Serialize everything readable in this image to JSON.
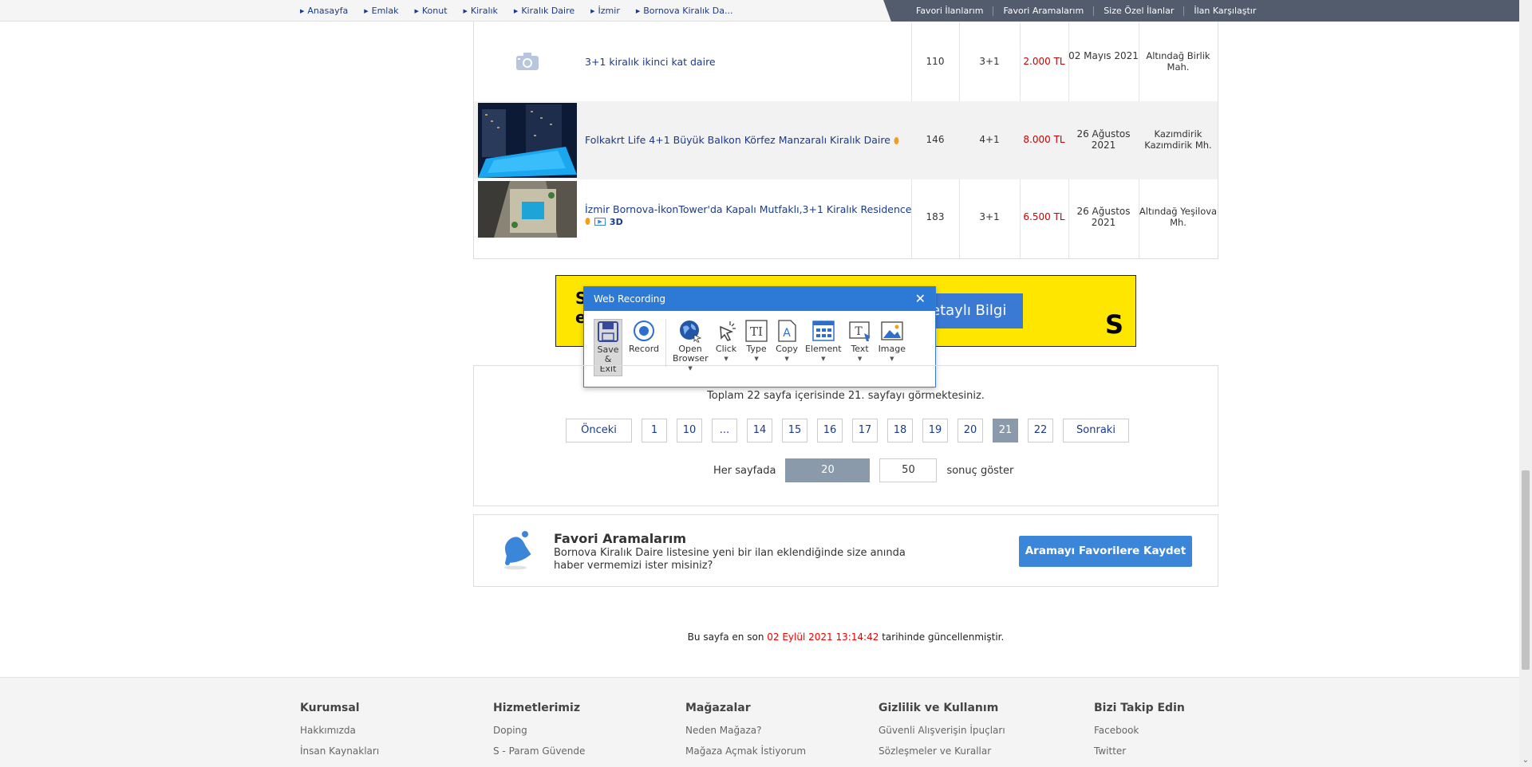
{
  "breadcrumb": [
    "Anasayfa",
    "Emlak",
    "Konut",
    "Kiralık",
    "Kiralık Daire",
    "İzmir",
    "Bornova Kiralık Da..."
  ],
  "topnav": [
    "Favori İlanlarım",
    "Favori Aramalarım",
    "Size Özel İlanlar",
    "İlan Karşılaştır"
  ],
  "listings": [
    {
      "title": "3+1 kiralık ikinci kat daire",
      "m2": "110",
      "rooms": "3+1",
      "price": "2.000 TL",
      "date": "02 Mayıs 2021",
      "location": "Altındağ Birlik Mah.",
      "thumb": "camera-placeholder-icon"
    },
    {
      "title": "Folkakrt Life 4+1 Büyük Balkon Körfez Manzaralı Kiralık Daire",
      "m2": "146",
      "rooms": "4+1",
      "price": "8.000 TL",
      "date": "26 Ağustos 2021",
      "location": "Kazımdirik Kazımdirik Mh.",
      "thumb": "pool-night-photo"
    },
    {
      "title": "İzmir Bornova-İkonTower'da Kapalı Mutfaklı,3+1 Kiralık Residence",
      "badge3d": "3D",
      "m2": "183",
      "rooms": "3+1",
      "price": "6.500 TL",
      "date": "26 Ağustos 2021",
      "location": "Altındağ Yeşilova Mh.",
      "thumb": "pool-aerial-photo"
    }
  ],
  "banner": {
    "button": "etaylı Bilgi",
    "right_letter": "S",
    "left_text": "S\ne"
  },
  "recorder": {
    "title": "Web Recording",
    "tools": [
      {
        "icon": "save-icon",
        "label": "Save & Exit"
      },
      {
        "icon": "record-icon",
        "label": "Record"
      },
      {
        "icon": "globe-icon",
        "label": "Open Browser"
      },
      {
        "icon": "click-icon",
        "label": "Click"
      },
      {
        "icon": "type-icon",
        "label": "Type"
      },
      {
        "icon": "copy-icon",
        "label": "Copy"
      },
      {
        "icon": "element-icon",
        "label": "Element"
      },
      {
        "icon": "text-icon",
        "label": "Text"
      },
      {
        "icon": "image-icon",
        "label": "Image"
      }
    ]
  },
  "pager": {
    "info": "Toplam 22 sayfa içerisinde 21. sayfayı görmektesiniz.",
    "prev": "Önceki",
    "next": "Sonraki",
    "pages": [
      "1",
      "10",
      "...",
      "14",
      "15",
      "16",
      "17",
      "18",
      "19",
      "20",
      "21",
      "22"
    ],
    "current": "21",
    "per_page_label": "Her sayfada",
    "per_page_options": [
      "20",
      "50"
    ],
    "per_page_current": "20",
    "per_page_suffix": "sonuç göster"
  },
  "fav": {
    "title": "Favori Aramalarım",
    "desc": "Bornova Kiralık Daire listesine yeni bir ilan eklendiğinde size anında haber vermemizi ister misiniz?",
    "button": "Aramayı Favorilere Kaydet"
  },
  "updated": {
    "prefix": "Bu sayfa en son",
    "date": "02 Eylül 2021 13:14:42",
    "suffix": "tarihinde güncellenmiştir."
  },
  "footer": [
    {
      "heading": "Kurumsal",
      "links": [
        "Hakkımızda",
        "İnsan Kaynakları"
      ]
    },
    {
      "heading": "Hizmetlerimiz",
      "links": [
        "Doping",
        "S - Param Güvende"
      ]
    },
    {
      "heading": "Mağazalar",
      "links": [
        "Neden Mağaza?",
        "Mağaza Açmak İstiyorum"
      ]
    },
    {
      "heading": "Gizlilik ve Kullanım",
      "links": [
        "Güvenli Alışverişin İpuçları",
        "Sözleşmeler ve Kurallar"
      ]
    },
    {
      "heading": "Bizi Takip Edin",
      "links": [
        "Facebook",
        "Twitter"
      ]
    }
  ]
}
